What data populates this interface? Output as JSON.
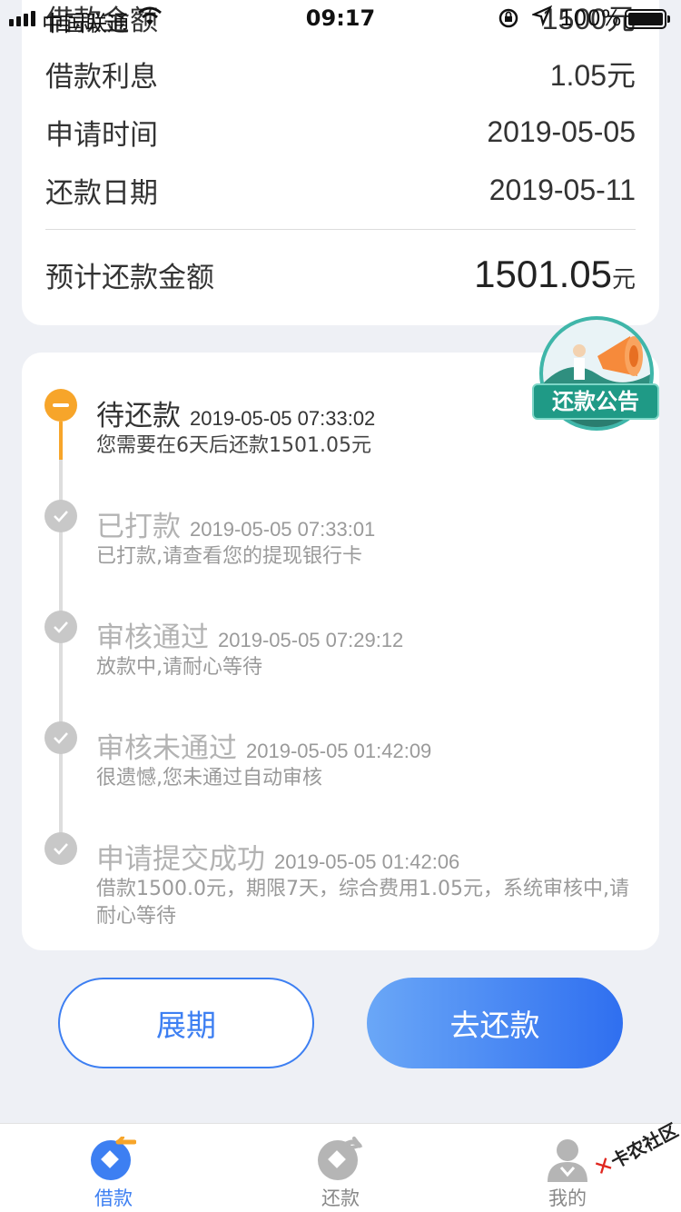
{
  "status_bar": {
    "carrier": "中国联通",
    "time": "09:17",
    "battery": "100%"
  },
  "summary": {
    "rows": [
      {
        "label": "借款金额",
        "value": "1500元"
      },
      {
        "label": "借款利息",
        "value": "1.05元"
      },
      {
        "label": "申请时间",
        "value": "2019-05-05"
      },
      {
        "label": "还款日期",
        "value": "2019-05-11"
      }
    ],
    "total_label": "预计还款金额",
    "total_amount": "1501.05",
    "total_unit": "元"
  },
  "notice": {
    "label": "还款公告",
    "icon": "megaphone-icon"
  },
  "timeline": [
    {
      "title": "待还款",
      "time": "2019-05-05 07:33:02",
      "desc": "您需要在6天后还款1501.05元",
      "state": "current"
    },
    {
      "title": "已打款",
      "time": "2019-05-05 07:33:01",
      "desc": "已打款,请查看您的提现银行卡",
      "state": "done"
    },
    {
      "title": "审核通过",
      "time": "2019-05-05 07:29:12",
      "desc": "放款中,请耐心等待",
      "state": "done"
    },
    {
      "title": "审核未通过",
      "time": "2019-05-05 01:42:09",
      "desc": "很遗憾,您未通过自动审核",
      "state": "done"
    },
    {
      "title": "申请提交成功",
      "time": "2019-05-05 01:42:06",
      "desc": "借款1500.0元，期限7天，综合费用1.05元，系统审核中,请耐心等待",
      "state": "done"
    }
  ],
  "buttons": {
    "extend": "展期",
    "repay": "去还款"
  },
  "tabs": [
    {
      "label": "借款",
      "icon": "loan-icon",
      "active": true
    },
    {
      "label": "还款",
      "icon": "repay-icon",
      "active": false
    },
    {
      "label": "我的",
      "icon": "profile-icon",
      "active": false
    }
  ],
  "watermark": "卡农社区",
  "colors": {
    "accent": "#3d7ff2",
    "current_step": "#f7a52a",
    "done_step": "#c8c8c8",
    "notice_green": "#1f9a86"
  }
}
